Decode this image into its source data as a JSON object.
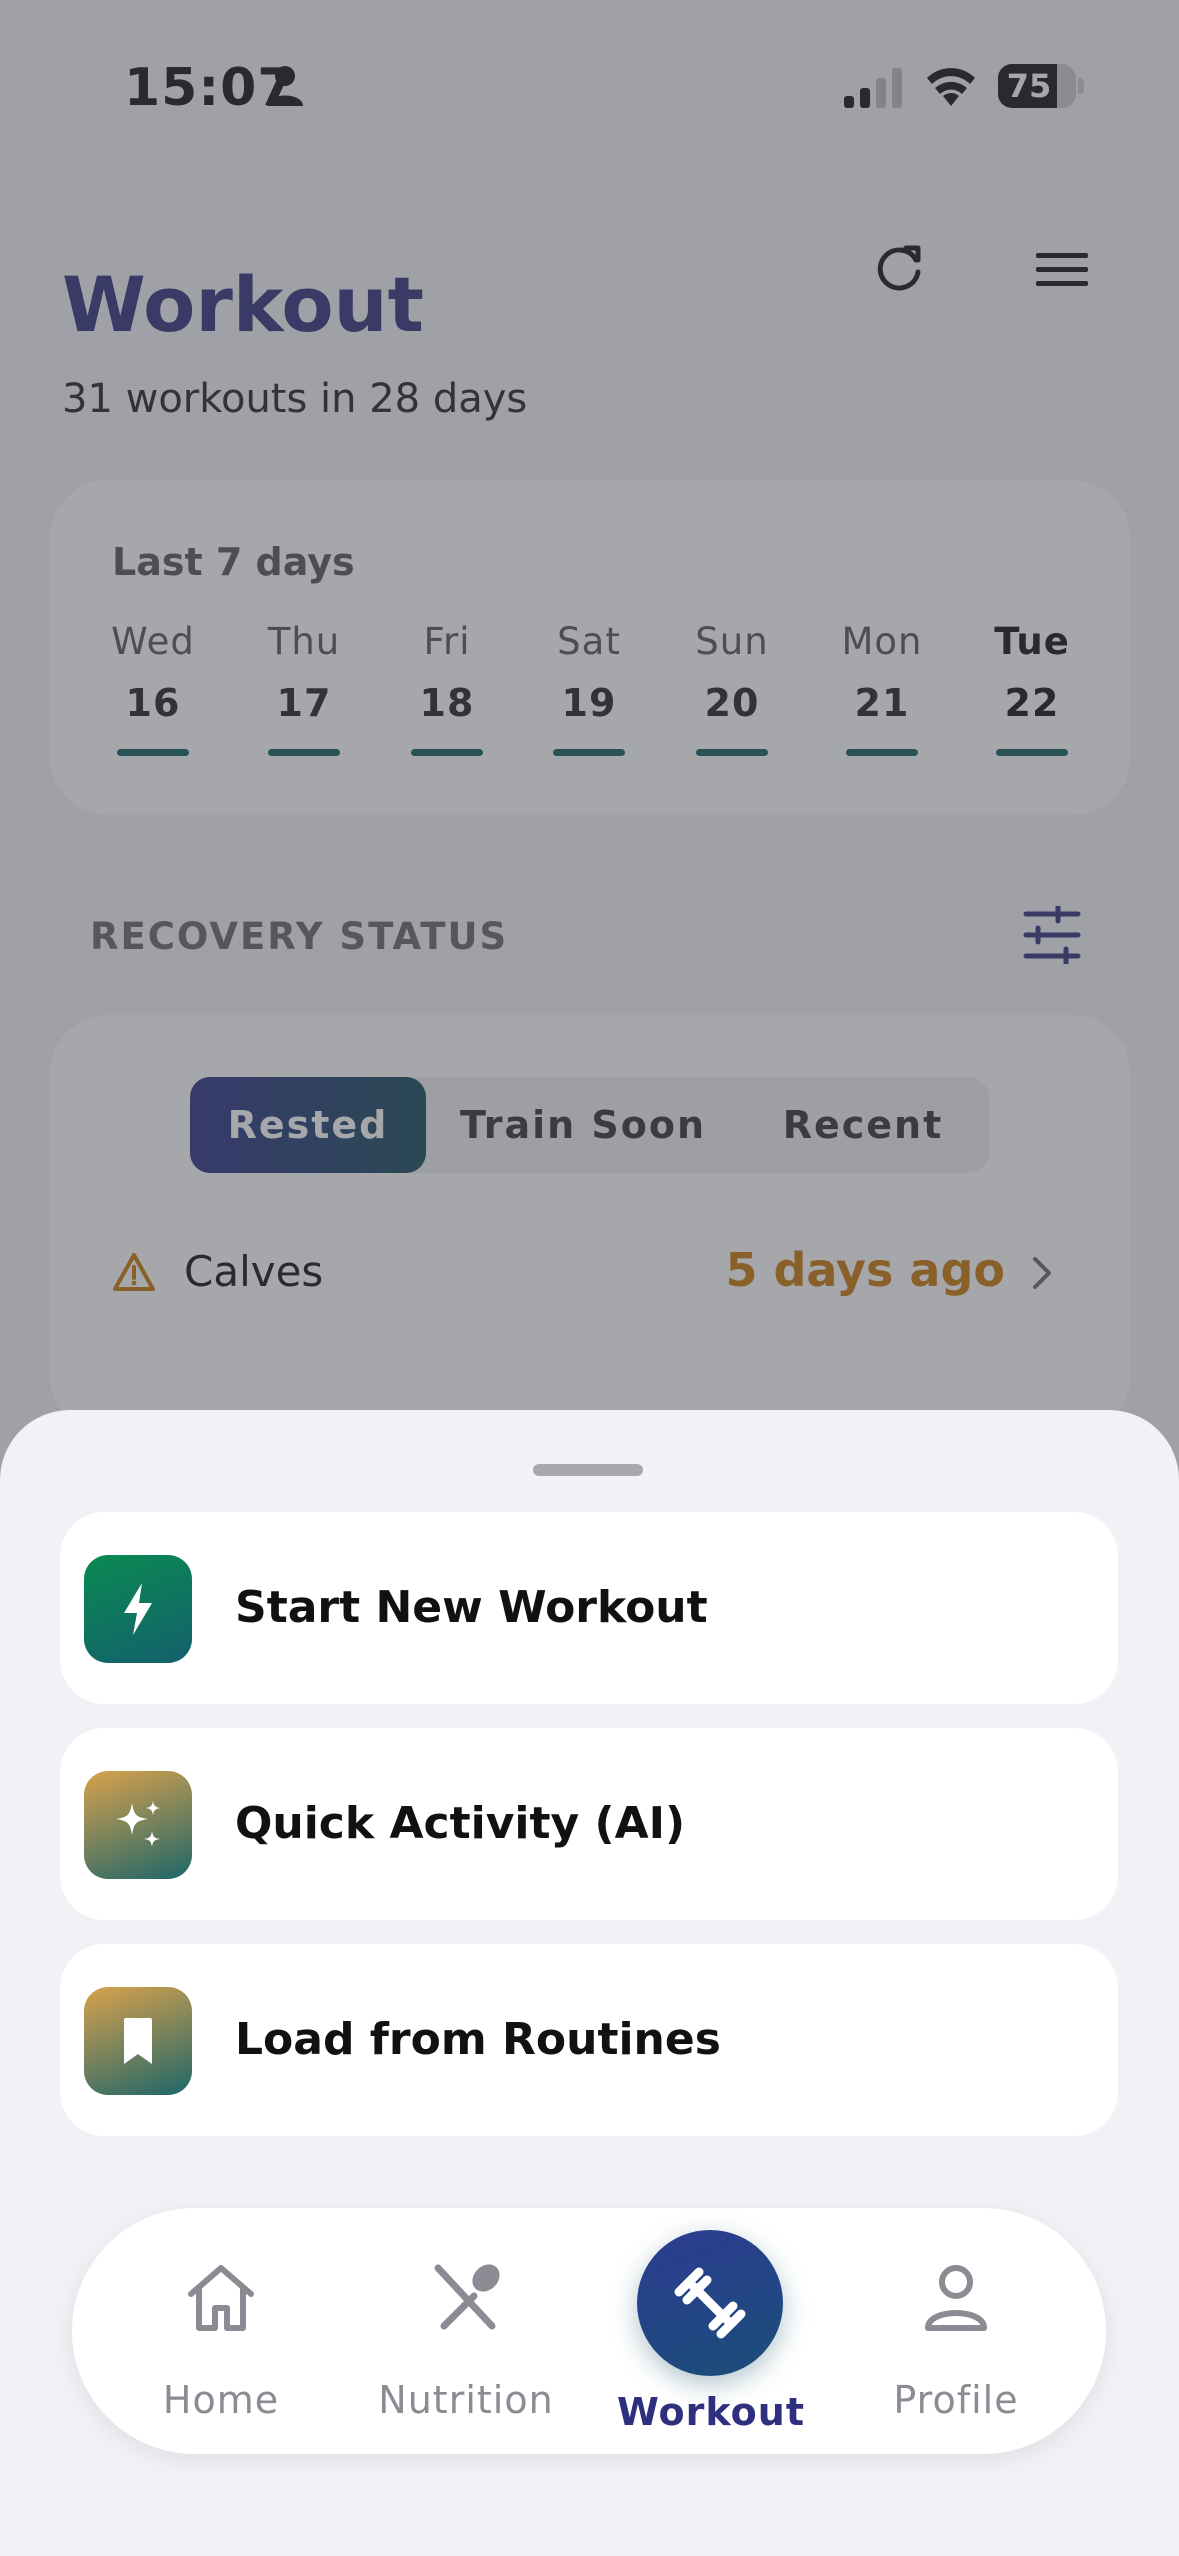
{
  "status_bar": {
    "time": "15:07",
    "battery": "75"
  },
  "header": {
    "title": "Workout",
    "subtitle": "31 workouts in 28 days"
  },
  "week": {
    "label": "Last 7 days",
    "days": [
      {
        "name": "Wed",
        "num": "16"
      },
      {
        "name": "Thu",
        "num": "17"
      },
      {
        "name": "Fri",
        "num": "18"
      },
      {
        "name": "Sat",
        "num": "19"
      },
      {
        "name": "Sun",
        "num": "20"
      },
      {
        "name": "Mon",
        "num": "21"
      },
      {
        "name": "Tue",
        "num": "22"
      }
    ]
  },
  "recovery": {
    "title": "RECOVERY STATUS",
    "segments": [
      "Rested",
      "Train Soon",
      "Recent"
    ],
    "items": [
      {
        "muscle": "Calves",
        "ago": "5 days ago"
      }
    ]
  },
  "sheet": {
    "actions": [
      {
        "label": "Start New Workout",
        "icon": "bolt-icon"
      },
      {
        "label": "Quick Activity (AI)",
        "icon": "sparkles-icon"
      },
      {
        "label": "Load from Routines",
        "icon": "bookmark-icon"
      }
    ]
  },
  "tabbar": {
    "tabs": [
      {
        "label": "Home",
        "icon": "house-icon"
      },
      {
        "label": "Nutrition",
        "icon": "fork-spoon-icon"
      },
      {
        "label": "Workout",
        "icon": "dumbbell-icon"
      },
      {
        "label": "Profile",
        "icon": "person-icon"
      }
    ]
  },
  "colors": {
    "accent": "#2e2f7e",
    "teal": "#0c5f5f",
    "warning": "#c7780a"
  }
}
